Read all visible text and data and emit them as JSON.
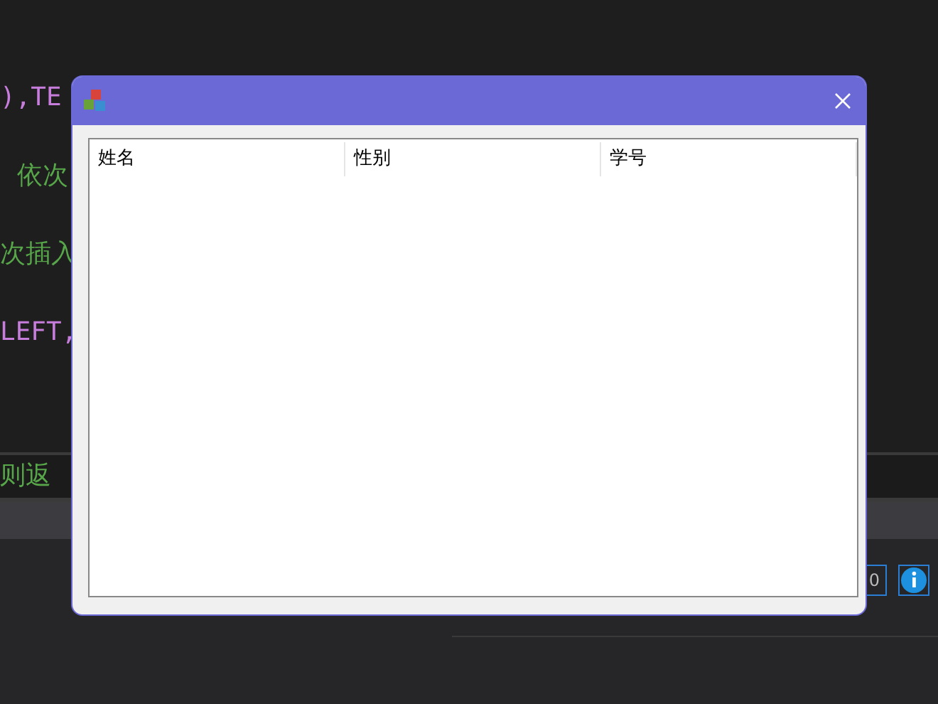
{
  "background": {
    "code_lines": [
      {
        "text": "),TE",
        "kind": "code"
      },
      {
        "text": "依次",
        "kind": "comment"
      },
      {
        "text": "次插入",
        "kind": "comment"
      },
      {
        "text": "LEFT,",
        "kind": "code"
      }
    ],
    "bottom_line": "则返",
    "panel": {
      "field_value": "0"
    }
  },
  "dialog": {
    "columns": [
      "姓名",
      "性别",
      "学号"
    ]
  }
}
